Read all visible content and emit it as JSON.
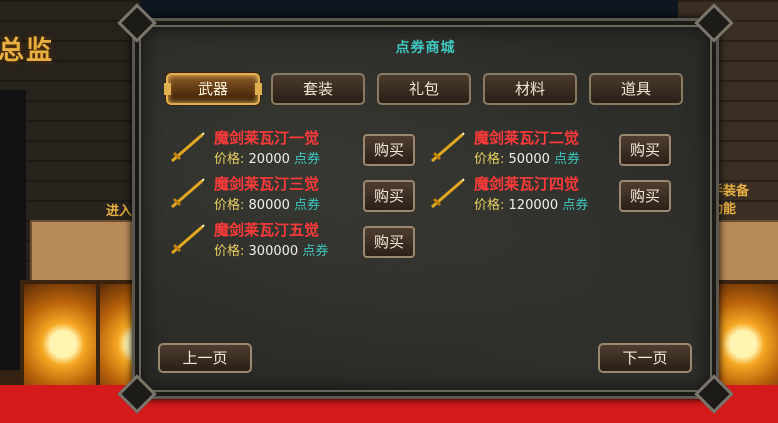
{
  "background": {
    "sign_left": "总监",
    "text_left": "进入",
    "text_right_1": "手装备",
    "text_right_2": "功能"
  },
  "dialog": {
    "title": "点券商城",
    "tabs": [
      {
        "label": "武器",
        "active": true
      },
      {
        "label": "套装",
        "active": false
      },
      {
        "label": "礼包",
        "active": false
      },
      {
        "label": "材料",
        "active": false
      },
      {
        "label": "道具",
        "active": false
      }
    ],
    "price_label": "价格:",
    "currency": "点券",
    "buy_label": "购买",
    "items": [
      {
        "name": "魔剑莱瓦汀一觉",
        "price": "20000",
        "icon": "golden-sword-icon"
      },
      {
        "name": "魔剑莱瓦汀二觉",
        "price": "50000",
        "icon": "golden-sword-icon"
      },
      {
        "name": "魔剑莱瓦汀三觉",
        "price": "80000",
        "icon": "golden-sword-icon"
      },
      {
        "name": "魔剑莱瓦汀四觉",
        "price": "120000",
        "icon": "golden-sword-icon"
      },
      {
        "name": "魔剑莱瓦汀五觉",
        "price": "300000",
        "icon": "golden-sword-icon"
      }
    ],
    "prev_page": "上一页",
    "next_page": "下一页"
  },
  "colors": {
    "title": "#3ec8c0",
    "item_name": "#ff3a3a",
    "price_label": "#e8d060",
    "currency": "#3ec8c0",
    "active_tab_border": "#e0b050"
  }
}
